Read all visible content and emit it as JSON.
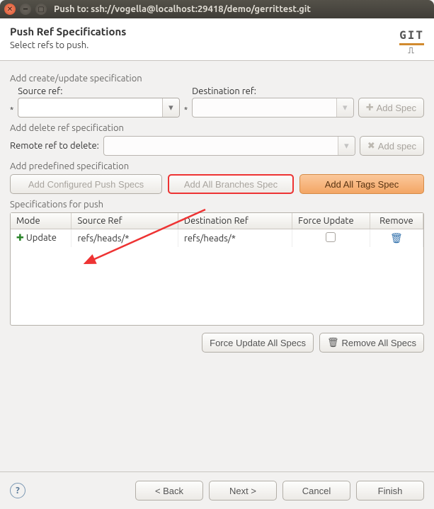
{
  "window": {
    "title": "Push to: ssh://vogella@localhost:29418/demo/gerrittest.git"
  },
  "header": {
    "title": "Push Ref Specifications",
    "subtitle": "Select refs to push.",
    "logo_text": "GIT"
  },
  "create_update": {
    "section": "Add create/update specification",
    "source_label": "Source ref:",
    "source_value": "",
    "dest_label": "Destination ref:",
    "dest_value": "",
    "add_spec_btn": "Add Spec"
  },
  "delete_ref": {
    "section": "Add delete ref specification",
    "remote_label": "Remote ref to delete:",
    "remote_value": "",
    "add_spec_btn": "Add spec"
  },
  "predefined": {
    "section": "Add predefined specification",
    "configured_btn": "Add Configured Push Specs",
    "branches_btn": "Add All Branches Spec",
    "tags_btn": "Add All Tags Spec"
  },
  "specs_table": {
    "section": "Specifications for push",
    "columns": {
      "mode": "Mode",
      "source": "Source Ref",
      "dest": "Destination Ref",
      "force": "Force Update",
      "remove": "Remove"
    },
    "rows": [
      {
        "mode": "Update",
        "source": "refs/heads/*",
        "dest": "refs/heads/*",
        "force": false
      }
    ]
  },
  "under_table": {
    "force_all": "Force Update All Specs",
    "remove_all": "Remove All Specs"
  },
  "footer": {
    "back": "< Back",
    "next": "Next >",
    "cancel": "Cancel",
    "finish": "Finish"
  }
}
